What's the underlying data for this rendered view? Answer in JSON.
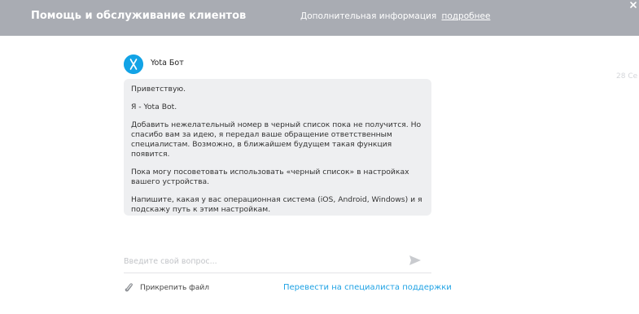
{
  "header": {
    "title": "Помощь и обслуживание клиентов",
    "info_text": "Дополнительная информация",
    "info_link": "подробнее"
  },
  "chat": {
    "date": "28 Се",
    "bot_name": "Yota Бот",
    "messages": [
      "Приветствую.",
      "Я - Yota Bot.",
      "Добавить нежелательный номер в черный список пока не получится. Но спасибо вам за идею, я передал ваше обращение ответственным специалистам. Возможно, в ближайшем будущем такая функция появится.",
      "Пока могу посоветовать использовать «черный список» в настройках вашего устройства.",
      "Напишите, какая у вас операционная система (iOS, Android, Windows) и я подскажу путь к этим настройкам."
    ]
  },
  "composer": {
    "placeholder": "Введите свой вопрос...",
    "value": "",
    "attach_label": "Прикрепить файл",
    "transfer_label": "Перевести на специалиста поддержки"
  },
  "colors": {
    "header_bg": "#a9acb3",
    "accent": "#1fa2e4",
    "bubble_bg": "#eeeff1"
  },
  "icons": [
    "close-icon",
    "yota-bot-avatar",
    "send-icon",
    "paperclip-icon"
  ]
}
